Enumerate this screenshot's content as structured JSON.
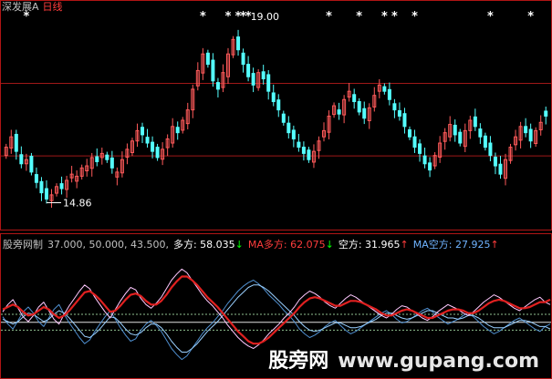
{
  "header": {
    "symbol": "深发展A",
    "period": "日线"
  },
  "chart_data": [
    {
      "type": "candlestick",
      "title": "",
      "annotations": {
        "high_label": "19.00",
        "low_label": "14.86",
        "star_glyph": "*"
      },
      "high_value": 19.0,
      "low_value": 14.86,
      "ylim": [
        14.3,
        19.4
      ],
      "reference_lines": [
        17.75,
        16.0
      ],
      "closes": [
        16.2,
        16.45,
        16.1,
        15.8,
        15.9,
        15.6,
        15.35,
        15.1,
        14.95,
        15.05,
        15.25,
        15.2,
        15.4,
        15.55,
        15.5,
        15.7,
        15.75,
        15.95,
        15.85,
        16.05,
        15.9,
        15.7,
        15.6,
        15.9,
        16.15,
        16.35,
        16.6,
        16.5,
        16.3,
        16.1,
        15.95,
        16.15,
        16.4,
        16.7,
        16.55,
        16.85,
        17.1,
        17.6,
        18.05,
        18.45,
        18.2,
        17.8,
        17.6,
        18.0,
        18.45,
        18.8,
        18.55,
        18.2,
        17.9,
        17.7,
        18.0,
        17.85,
        17.55,
        17.3,
        17.1,
        16.8,
        16.55,
        16.4,
        16.2,
        16.05,
        15.9,
        16.1,
        16.35,
        16.6,
        16.95,
        17.2,
        17.0,
        17.35,
        17.55,
        17.3,
        17.05,
        16.9,
        17.15,
        17.45,
        17.7,
        17.55,
        17.35,
        17.1,
        16.95,
        16.7,
        16.45,
        16.2,
        16.05,
        15.8,
        15.65,
        16.0,
        16.3,
        16.55,
        16.75,
        16.5,
        16.3,
        16.6,
        16.85,
        16.7,
        16.45,
        16.2,
        16.0,
        15.75,
        15.55,
        15.9,
        16.2,
        16.45,
        16.7,
        16.55,
        16.35,
        16.6,
        16.8,
        16.95
      ],
      "stars_at": [
        4,
        39,
        44,
        46,
        47,
        48,
        64,
        70,
        75,
        77,
        81,
        96,
        104
      ],
      "high_index": 47,
      "low_index": 8
    },
    {
      "type": "line",
      "title": "股旁网制",
      "params_text": "37.000, 50.000, 43.500,",
      "series": [
        {
          "name": "多方",
          "value_text": "58.035",
          "arrow": "↓",
          "color": "#ffffff",
          "role": "main"
        },
        {
          "name": "MA多方",
          "value_text": "62.075",
          "arrow": "↓",
          "color": "#ff3c3c",
          "role": "ma"
        },
        {
          "name": "空方",
          "value_text": "31.965",
          "arrow": "↑",
          "color": "#ffffff",
          "role": "sec"
        },
        {
          "name": "MA空方",
          "value_text": "27.925",
          "arrow": "↑",
          "color": "#6fb3ff",
          "role": "ma2"
        }
      ],
      "levels": [
        50.0,
        43.5,
        37.0
      ],
      "ylim": [
        0,
        100
      ],
      "bull": [
        52,
        58,
        62,
        55,
        48,
        44,
        49,
        56,
        60,
        53,
        46,
        42,
        50,
        57,
        63,
        69,
        74,
        71,
        64,
        58,
        52,
        47,
        54,
        61,
        67,
        72,
        70,
        63,
        58,
        55,
        59,
        64,
        71,
        78,
        83,
        87,
        84,
        78,
        72,
        66,
        61,
        57,
        52,
        47,
        41,
        36,
        31,
        27,
        24,
        22,
        25,
        29,
        34,
        38,
        42,
        47,
        51,
        56,
        62,
        66,
        69,
        67,
        64,
        60,
        57,
        55,
        59,
        63,
        66,
        64,
        61,
        58,
        55,
        52,
        49,
        47,
        50,
        54,
        57,
        56,
        53,
        50,
        47,
        45,
        48,
        52,
        55,
        58,
        56,
        54,
        51,
        49,
        52,
        56,
        60,
        63,
        66,
        64,
        61,
        58,
        55,
        53,
        56,
        59,
        62,
        64,
        60,
        58
      ],
      "ma_bull": [
        54,
        56,
        58,
        56,
        52,
        49,
        50,
        53,
        56,
        54,
        50,
        47,
        49,
        53,
        58,
        63,
        68,
        69,
        66,
        62,
        57,
        52,
        53,
        57,
        62,
        66,
        67,
        65,
        61,
        58,
        58,
        61,
        66,
        72,
        77,
        81,
        81,
        78,
        74,
        69,
        64,
        60,
        56,
        51,
        46,
        41,
        36,
        32,
        28,
        26,
        26,
        28,
        31,
        35,
        39,
        43,
        47,
        51,
        56,
        60,
        63,
        64,
        63,
        61,
        59,
        57,
        57,
        59,
        61,
        61,
        60,
        58,
        56,
        54,
        51,
        49,
        49,
        51,
        53,
        54,
        53,
        51,
        49,
        47,
        47,
        49,
        51,
        53,
        54,
        54,
        53,
        51,
        51,
        53,
        56,
        59,
        61,
        62,
        61,
        59,
        57,
        55,
        55,
        56,
        58,
        60,
        60,
        62
      ],
      "bear": [
        48,
        42,
        38,
        45,
        52,
        56,
        51,
        44,
        40,
        47,
        54,
        58,
        50,
        43,
        37,
        31,
        26,
        29,
        36,
        42,
        48,
        53,
        46,
        39,
        33,
        28,
        30,
        37,
        42,
        45,
        41,
        36,
        29,
        22,
        17,
        13,
        16,
        22,
        28,
        34,
        39,
        43,
        48,
        53,
        59,
        64,
        69,
        73,
        76,
        78,
        75,
        71,
        66,
        62,
        58,
        53,
        49,
        44,
        38,
        34,
        31,
        33,
        36,
        40,
        43,
        45,
        41,
        37,
        34,
        36,
        39,
        42,
        45,
        48,
        51,
        53,
        50,
        46,
        43,
        44,
        47,
        50,
        53,
        55,
        52,
        48,
        45,
        42,
        44,
        46,
        49,
        51,
        48,
        44,
        40,
        37,
        34,
        36,
        39,
        42,
        45,
        47,
        44,
        41,
        38,
        36,
        40,
        42
      ],
      "ma_bear": [
        46,
        44,
        42,
        44,
        48,
        51,
        50,
        47,
        44,
        46,
        50,
        53,
        51,
        47,
        42,
        37,
        32,
        31,
        34,
        38,
        43,
        48,
        47,
        43,
        38,
        34,
        33,
        35,
        39,
        42,
        42,
        39,
        34,
        28,
        23,
        19,
        19,
        22,
        26,
        31,
        36,
        40,
        44,
        49,
        54,
        59,
        64,
        68,
        72,
        74,
        74,
        72,
        69,
        65,
        61,
        57,
        53,
        49,
        44,
        40,
        37,
        36,
        37,
        39,
        41,
        43,
        43,
        41,
        39,
        39,
        40,
        42,
        44,
        46,
        49,
        51,
        51,
        49,
        47,
        46,
        47,
        49,
        51,
        53,
        53,
        51,
        49,
        47,
        47,
        46,
        47,
        49,
        49,
        47,
        44,
        41,
        39,
        39,
        39,
        41,
        43,
        45,
        45,
        44,
        42,
        40,
        40,
        38
      ]
    }
  ],
  "watermark": {
    "part1": "股旁网",
    "part2": "www.gupang.com"
  },
  "colors": {
    "background": "#000000",
    "frame": "#b01515",
    "reference": "#a01818",
    "up_candle": "#ff5a5a",
    "down_candle": "#54ffff",
    "star": "#ffffff",
    "title_text": "#c0c0c0",
    "header_red": "#ff3c3c",
    "level_line": "#d8d8d8"
  }
}
